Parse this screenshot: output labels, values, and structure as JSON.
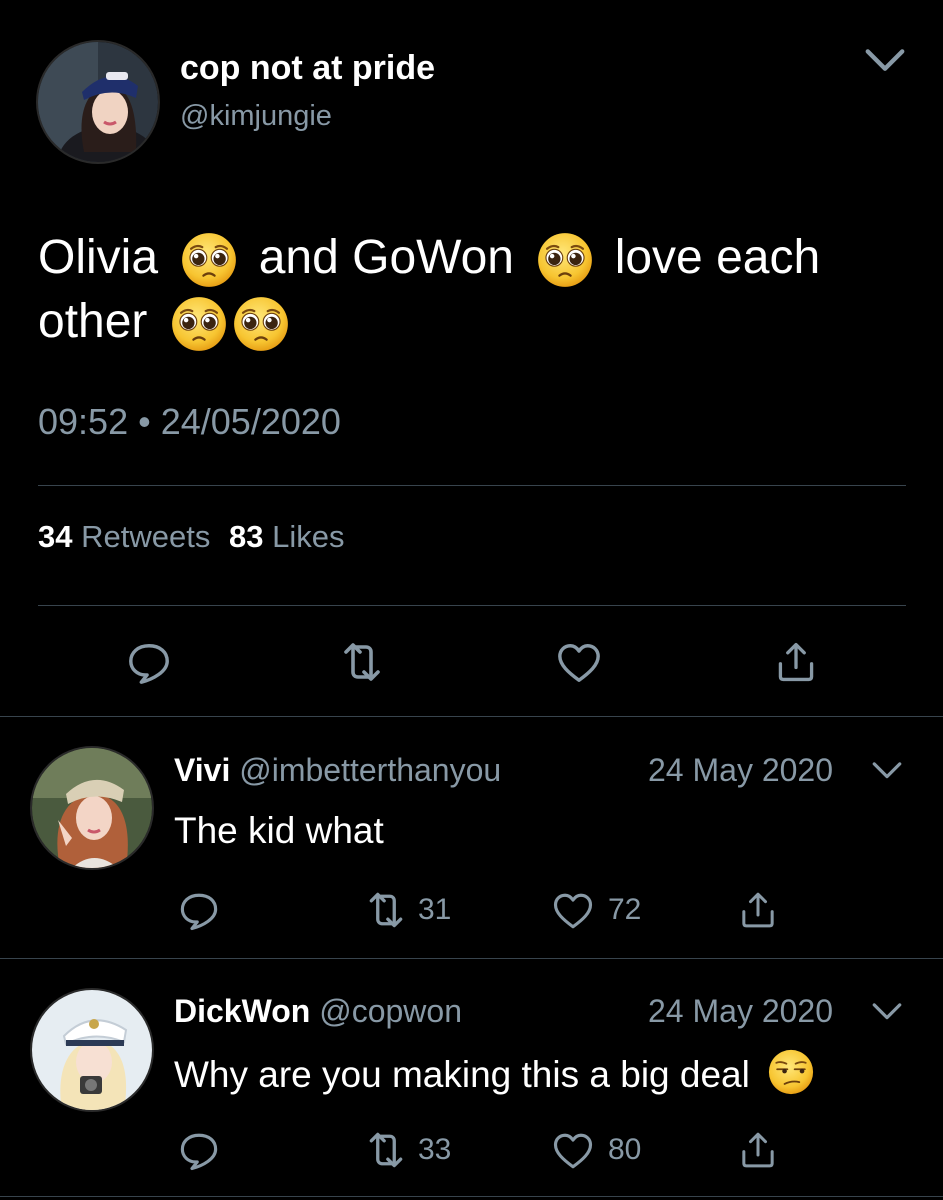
{
  "main_tweet": {
    "display_name": "cop not at pride",
    "handle": "@kimjungie",
    "text": {
      "w1": "Olivia",
      "w2": "and GoWon",
      "w3": "love each",
      "w4": "other"
    },
    "time": "09:52",
    "dot": "•",
    "date": "24/05/2020",
    "retweets_count": "34",
    "retweets_label": "Retweets",
    "likes_count": "83",
    "likes_label": "Likes"
  },
  "replies": [
    {
      "display_name": "Vivi",
      "handle": "@imbetterthanyou",
      "date": "24 May 2020",
      "text": "The kid what",
      "retweets": "31",
      "likes": "72"
    },
    {
      "display_name": "DickWon",
      "handle": "@copwon",
      "date": "24 May 2020",
      "text": "Why are you making this a big deal",
      "retweets": "33",
      "likes": "80"
    }
  ],
  "colors": {
    "background": "#000000",
    "text": "#ffffff",
    "secondary": "#8899a6",
    "divider": "#38444d",
    "emoji": "#f7c531"
  },
  "icons": [
    "pleading-face-emoji",
    "unamused-face-emoji",
    "reply-icon",
    "retweet-icon",
    "like-icon",
    "share-icon",
    "chevron-down-icon"
  ]
}
